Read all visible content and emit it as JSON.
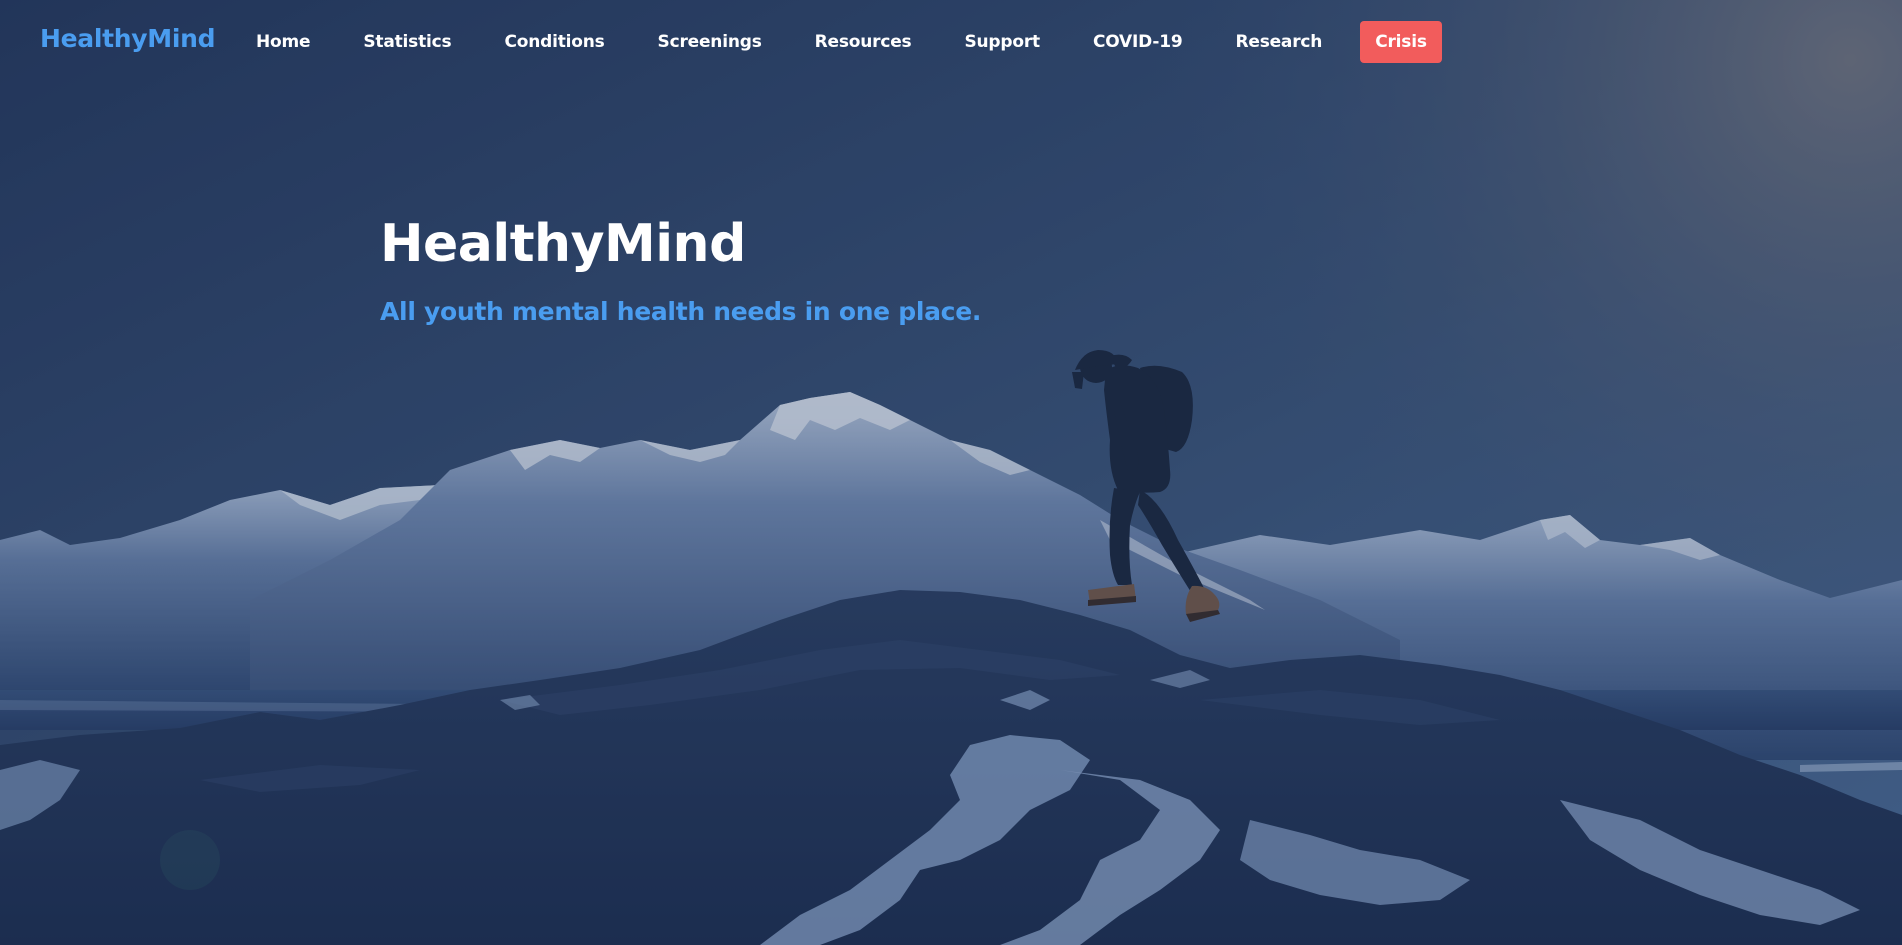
{
  "nav": {
    "brand": "HealthyMind",
    "links": [
      {
        "label": "Home"
      },
      {
        "label": "Statistics"
      },
      {
        "label": "Conditions"
      },
      {
        "label": "Screenings"
      },
      {
        "label": "Resources"
      },
      {
        "label": "Support"
      },
      {
        "label": "COVID-19"
      },
      {
        "label": "Research"
      }
    ],
    "crisis_label": "Crisis"
  },
  "hero": {
    "title": "HealthyMind",
    "tagline": "All youth mental health needs in one place.",
    "background": "mountain-hiker-photo"
  },
  "colors": {
    "accent": "#4a9df0",
    "crisis": "#f25c5c",
    "overlay": "#1e3358"
  }
}
